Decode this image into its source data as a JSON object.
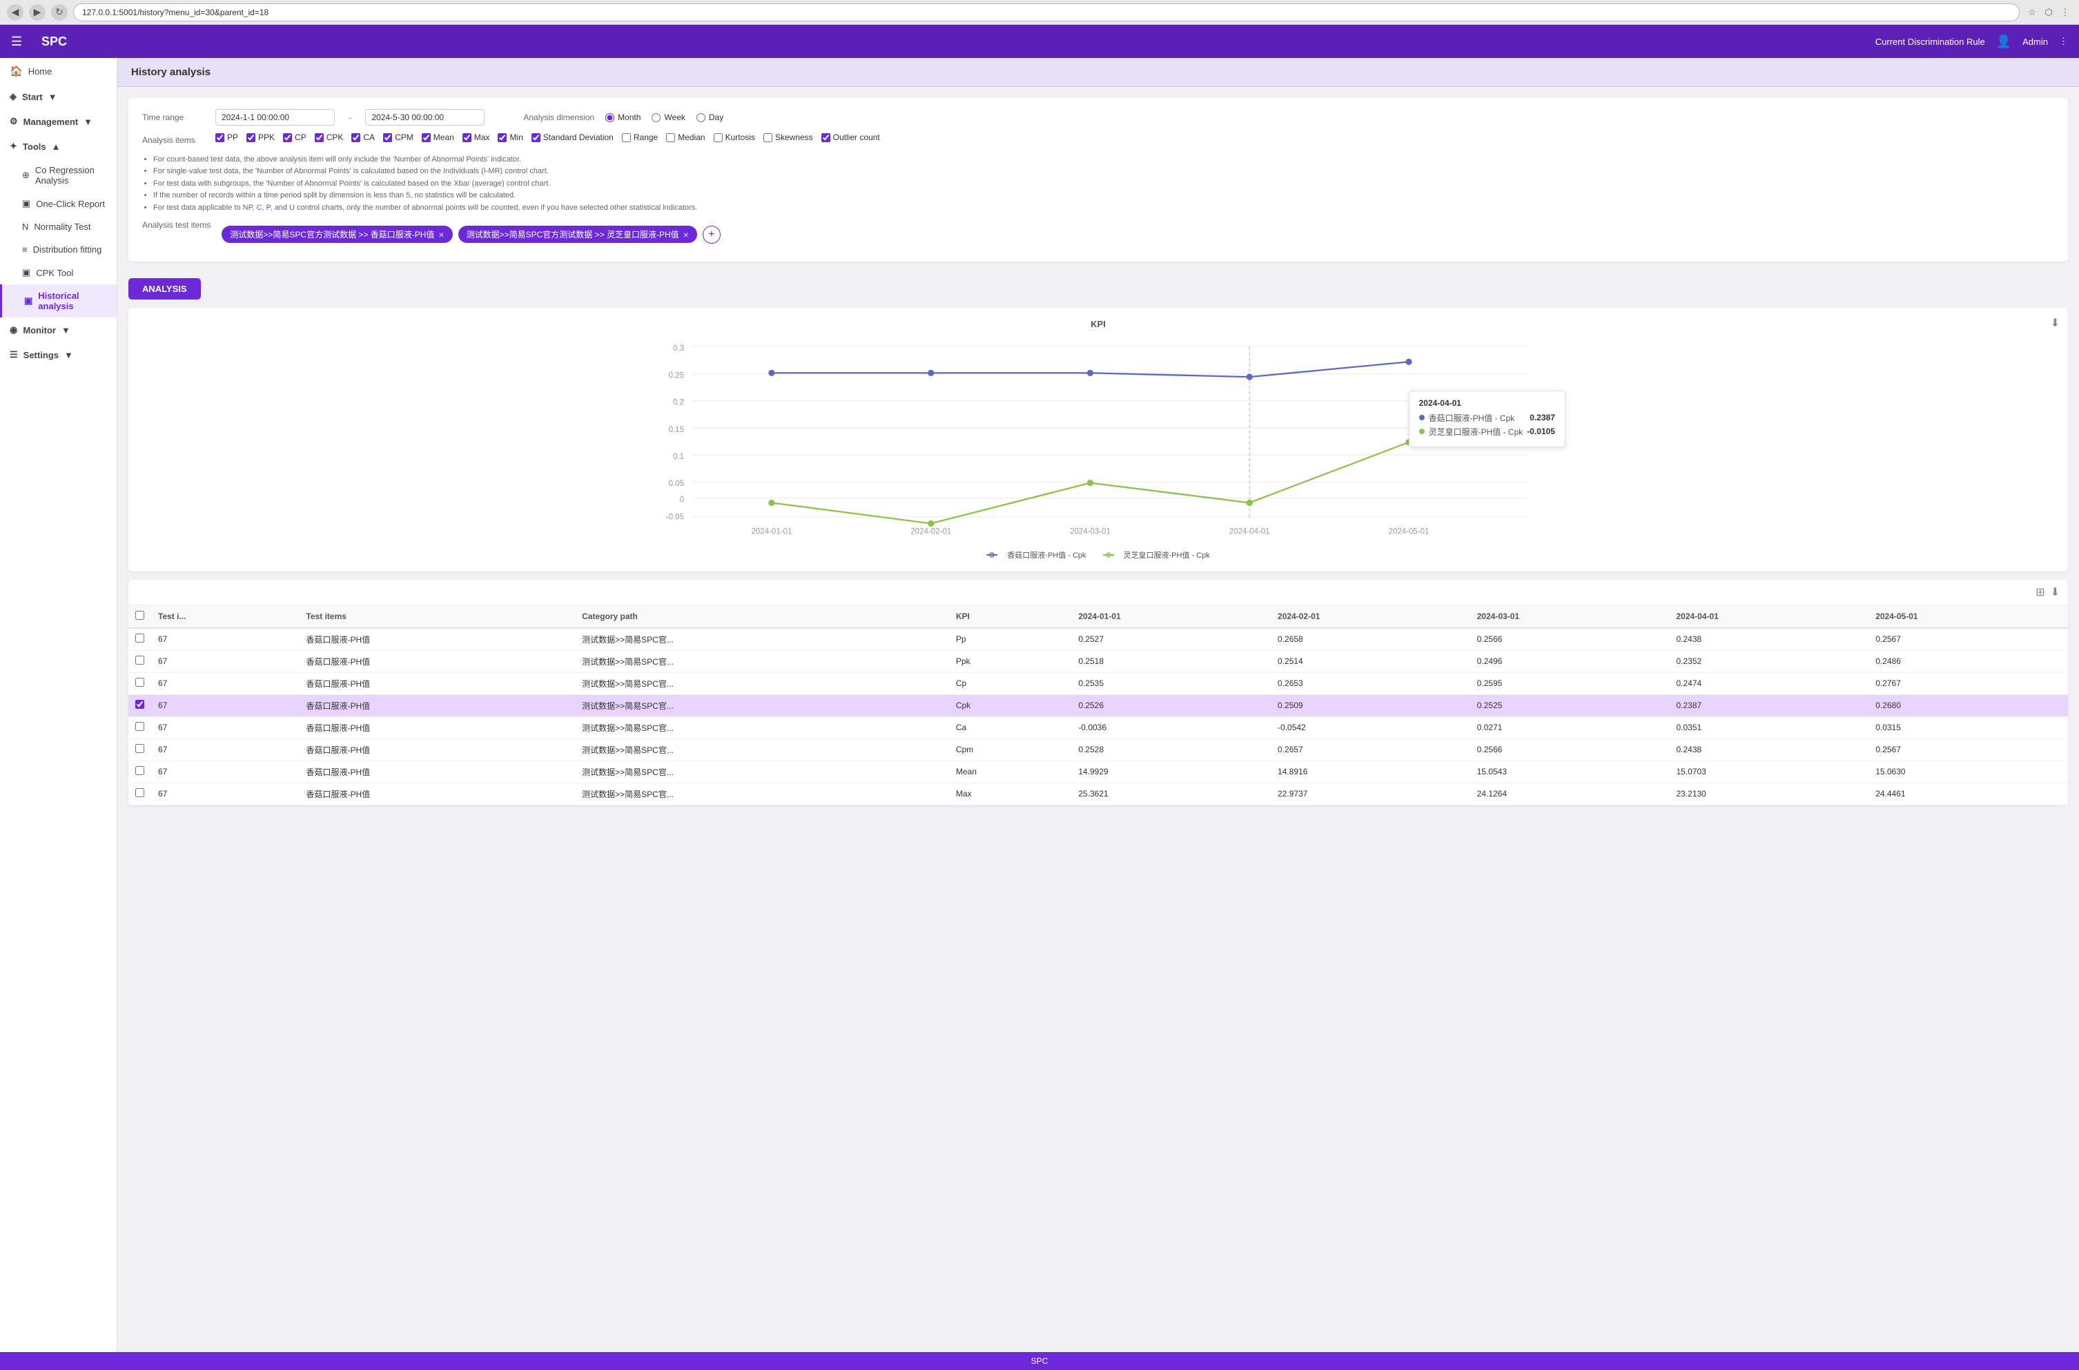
{
  "browser": {
    "url": "127.0.0.1:5001/history?menu_id=30&parent_id=18",
    "back": "◀",
    "forward": "▶",
    "refresh": "↻"
  },
  "header": {
    "menu_icon": "☰",
    "app_title": "SPC",
    "discrimination_label": "Current Discrimination Rule",
    "admin_label": "Admin"
  },
  "sidebar": {
    "home_label": "Home",
    "start_label": "Start",
    "management_label": "Management",
    "tools_label": "Tools",
    "sub_items": [
      {
        "label": "Regression Analysis",
        "icon": "⊕"
      },
      {
        "label": "One-Click Report",
        "icon": "▣"
      },
      {
        "label": "Normality Test",
        "icon": "N"
      },
      {
        "label": "Distribution fitting",
        "icon": "≡"
      },
      {
        "label": "CPK Tool",
        "icon": "▣"
      },
      {
        "label": "Historical analysis",
        "icon": "▣"
      }
    ],
    "monitor_label": "Monitor",
    "settings_label": "Settings"
  },
  "page_title": "History analysis",
  "filter": {
    "time_range_label": "Time range",
    "date_start": "2024-1-1 00:00:00",
    "date_end": "2024-5-30 00:00:00",
    "date_dash": "-",
    "analysis_dimension_label": "Analysis dimension",
    "dimension_options": [
      "Month",
      "Week",
      "Day"
    ],
    "dimension_selected": "Month",
    "analysis_items_label": "Analysis items",
    "checkboxes": [
      {
        "id": "PP",
        "label": "PP",
        "checked": true
      },
      {
        "id": "PPK",
        "label": "PPK",
        "checked": true
      },
      {
        "id": "CP",
        "label": "CP",
        "checked": true
      },
      {
        "id": "CPK",
        "label": "CPK",
        "checked": true
      },
      {
        "id": "CA",
        "label": "CA",
        "checked": true
      },
      {
        "id": "CPM",
        "label": "CPM",
        "checked": true
      },
      {
        "id": "Mean",
        "label": "Mean",
        "checked": true
      },
      {
        "id": "Max",
        "label": "Max",
        "checked": true
      },
      {
        "id": "Min",
        "label": "Min",
        "checked": true
      },
      {
        "id": "StdDev",
        "label": "Standard Deviation",
        "checked": true
      },
      {
        "id": "Range",
        "label": "Range",
        "checked": false
      },
      {
        "id": "Median",
        "label": "Median",
        "checked": false
      },
      {
        "id": "Kurtosis",
        "label": "Kurtosis",
        "checked": false
      },
      {
        "id": "Skewness",
        "label": "Skewness",
        "checked": false
      },
      {
        "id": "OutlierCount",
        "label": "Outlier count",
        "checked": true
      }
    ],
    "info_bullets": [
      "For count-based test data, the above analysis item will only include the 'Number of Abnormal Points' indicator.",
      "For single-value test data, the 'Number of Abnormal Points' is calculated based on the Individuals (I-MR) control chart.",
      "For test data with subgroups, the 'Number of Abnormal Points' is calculated based on the Xbar (average) control chart.",
      "If the number of records within a time period split by dimension is less than 5, no statistics will be calculated.",
      "For test data applicable to NP, C, P, and U control charts, only the number of abnormal points will be counted, even if you have selected other statistical indicators."
    ],
    "analysis_test_items_label": "Analysis test items",
    "tags": [
      {
        "label": "测试数据>>简易SPC官方测试数据 >> 香菇口服液-PH值"
      },
      {
        "label": "测试数据>>简易SPC官方测试数据 >> 灵芝皇口服液-PH值"
      }
    ],
    "add_icon": "+"
  },
  "analysis_button": "ANALYSIS",
  "chart": {
    "title": "KPI",
    "download_icon": "⬇",
    "x_labels": [
      "2024-01-01",
      "2024-02-01",
      "2024-03-01",
      "2024-04-01",
      "2024-05-01"
    ],
    "series1_label": "香菇口服液-PH值 - Cpk",
    "series1_color": "#5b6abf",
    "series2_label": "灵芝皇口服液-PH值 - Cpk",
    "series2_color": "#8bc34a",
    "series1_points": [
      0.25,
      0.25,
      0.25,
      0.24,
      0.27
    ],
    "series2_points": [
      -0.01,
      -0.05,
      0.03,
      -0.01,
      0.11
    ],
    "tooltip": {
      "date": "2024-04-01",
      "row1_label": "香菇口服液-PH值 - Cpk",
      "row1_value": "0.2387",
      "row1_color": "#5b6abf",
      "row2_label": "灵芝皇口服液-PH值 - Cpk",
      "row2_value": "-0.0105",
      "row2_color": "#8bc34a"
    }
  },
  "table": {
    "columns": [
      "",
      "Test i...",
      "Test items",
      "Category path",
      "KPI",
      "2024-01-01",
      "2024-02-01",
      "2024-03-01",
      "2024-04-01",
      "2024-05-01"
    ],
    "rows": [
      {
        "id": 67,
        "test_item": "香菇口服液-PH值",
        "category": "测试数据>>简易SPC官...",
        "kpi": "Pp",
        "v1": "0.2527",
        "v2": "0.2658",
        "v3": "0.2566",
        "v4": "0.2438",
        "v5": "0.2567",
        "highlighted": false
      },
      {
        "id": 67,
        "test_item": "香菇口服液-PH值",
        "category": "测试数据>>简易SPC官...",
        "kpi": "Ppk",
        "v1": "0.2518",
        "v2": "0.2514",
        "v3": "0.2496",
        "v4": "0.2352",
        "v5": "0.2486",
        "highlighted": false
      },
      {
        "id": 67,
        "test_item": "香菇口服液-PH值",
        "category": "测试数据>>简易SPC官...",
        "kpi": "Cp",
        "v1": "0.2535",
        "v2": "0.2653",
        "v3": "0.2595",
        "v4": "0.2474",
        "v5": "0.2767",
        "highlighted": false
      },
      {
        "id": 67,
        "test_item": "香菇口服液-PH值",
        "category": "测试数据>>简易SPC官...",
        "kpi": "Cpk",
        "v1": "0.2526",
        "v2": "0.2509",
        "v3": "0.2525",
        "v4": "0.2387",
        "v5": "0.2680",
        "highlighted": true
      },
      {
        "id": 67,
        "test_item": "香菇口服液-PH值",
        "category": "测试数据>>简易SPC官...",
        "kpi": "Ca",
        "v1": "-0.0036",
        "v2": "-0.0542",
        "v3": "0.0271",
        "v4": "0.0351",
        "v5": "0.0315",
        "highlighted": false
      },
      {
        "id": 67,
        "test_item": "香菇口服液-PH值",
        "category": "测试数据>>简易SPC官...",
        "kpi": "Cpm",
        "v1": "0.2528",
        "v2": "0.2657",
        "v3": "0.2566",
        "v4": "0.2438",
        "v5": "0.2567",
        "highlighted": false
      },
      {
        "id": 67,
        "test_item": "香菇口服液-PH值",
        "category": "测试数据>>简易SPC官...",
        "kpi": "Mean",
        "v1": "14.9929",
        "v2": "14.8916",
        "v3": "15.0543",
        "v4": "15.0703",
        "v5": "15.0630",
        "highlighted": false
      },
      {
        "id": 67,
        "test_item": "香菇口服液-PH值",
        "category": "测试数据>>简易SPC官...",
        "kpi": "Max",
        "v1": "25.3621",
        "v2": "22.9737",
        "v3": "24.1264",
        "v4": "23.2130",
        "v5": "24.4461",
        "highlighted": false
      }
    ]
  },
  "bottom_bar_label": "SPC"
}
